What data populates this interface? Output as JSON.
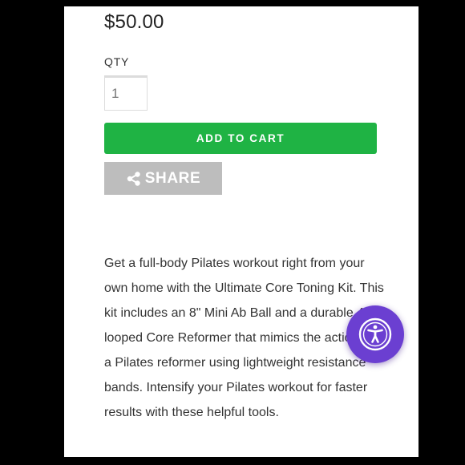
{
  "product": {
    "price": "$50.00",
    "qty_label": "QTY",
    "qty_value": "1",
    "add_to_cart_label": "ADD TO CART",
    "share_label": "SHARE",
    "share_icon": "share-icon",
    "description": "Get a full-body Pilates workout right from your own home with the Ultimate Core Toning Kit. This kit includes an 8\" Mini Ab Ball and a durable 4-looped Core Reformer that mimics the actions of a Pilates reformer using lightweight resistance bands. Intensify your Pilates workout for faster results with these helpful tools."
  },
  "accessibility_widget": {
    "icon": "accessibility-icon",
    "color": "#6b3fd1"
  },
  "colors": {
    "add_to_cart": "#1fb344",
    "share": "#bdbdbd",
    "background": "#000000",
    "page": "#ffffff"
  }
}
